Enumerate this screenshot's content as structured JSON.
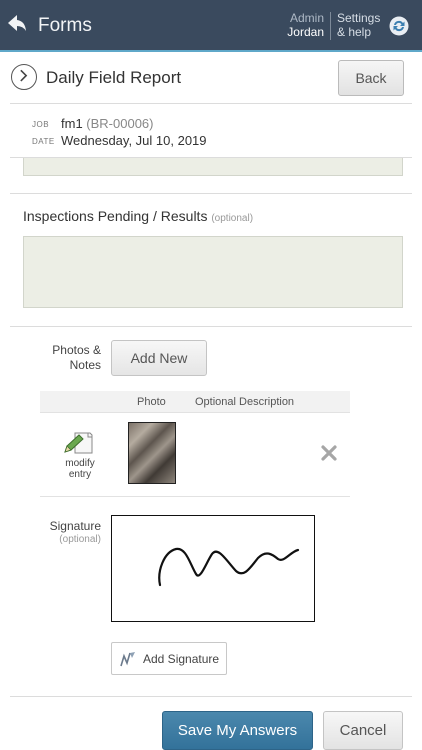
{
  "app": {
    "title": "Forms",
    "user_role": "Admin",
    "user_name": "Jordan",
    "settings_line1": "Settings",
    "settings_line2": "& help"
  },
  "header": {
    "title": "Daily Field Report",
    "back_label": "Back"
  },
  "job_info": {
    "job_label": "JOB",
    "job_name": "fm1",
    "job_code": "(BR-00006)",
    "date_label": "DATE",
    "date_value": "Wednesday, Jul 10, 2019"
  },
  "inspections": {
    "label": "Inspections Pending / Results",
    "optional": "(optional)",
    "value": ""
  },
  "photos": {
    "label_line1": "Photos &",
    "label_line2": "Notes",
    "add_new_label": "Add New",
    "columns": [
      "Photo",
      "Optional Description"
    ],
    "rows": [
      {
        "modify_line1": "modify",
        "modify_line2": "entry",
        "description": ""
      }
    ]
  },
  "signature": {
    "label": "Signature",
    "optional": "(optional)",
    "add_label": "Add Signature"
  },
  "footer": {
    "save_label": "Save My Answers",
    "cancel_label": "Cancel"
  },
  "colors": {
    "topbar": "#3a4a5e",
    "accent": "#3f7ea5",
    "textbox": "#eceee5"
  },
  "icons": {
    "back": "back-arrow-icon",
    "sync": "sync-icon",
    "chevron": "chevron-right-icon",
    "modify": "pencil-note-icon",
    "remove": "close-icon",
    "signature": "signature-pen-icon"
  }
}
